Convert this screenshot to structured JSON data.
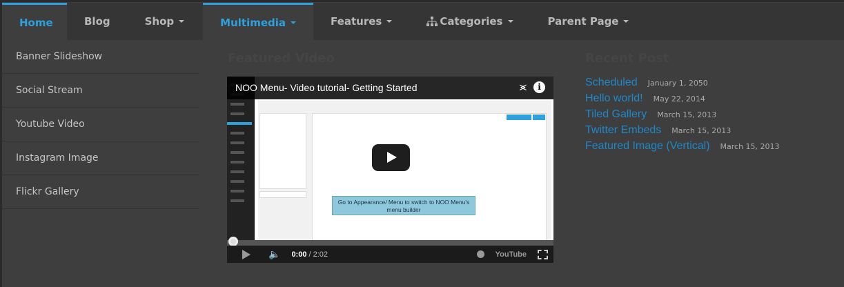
{
  "nav": [
    {
      "label": "Home",
      "dropdown": false,
      "active": true
    },
    {
      "label": "Blog",
      "dropdown": false
    },
    {
      "label": "Shop",
      "dropdown": true
    },
    {
      "label": "Multimedia",
      "dropdown": true,
      "active": true
    },
    {
      "label": "Features",
      "dropdown": true
    },
    {
      "label": "Categories",
      "dropdown": true,
      "icon": "sitemap-icon"
    },
    {
      "label": "Parent Page",
      "dropdown": true
    }
  ],
  "submenu": [
    "Banner Slideshow",
    "Social Stream",
    "Youtube Video",
    "Instagram Image",
    "Flickr Gallery"
  ],
  "featured_heading": "Featured Video",
  "video": {
    "title": "NOO Menu- Video tutorial- Getting Started",
    "annotation": "Go to Appearance/ Menu to switch to NOO Menu's menu builder",
    "current_time": "0:00",
    "duration": "/ 2:02",
    "brand": "YouTube",
    "progress": 0
  },
  "recent_heading": "Recent Post",
  "posts": [
    {
      "title": "Scheduled",
      "date": "January 1, 2050"
    },
    {
      "title": "Hello world!",
      "date": "May 22, 2014"
    },
    {
      "title": "Tiled Gallery",
      "date": "March 15, 2013"
    },
    {
      "title": "Twitter Embeds",
      "date": "March 15, 2013"
    },
    {
      "title": "Featured Image (Vertical)",
      "date": "March 15, 2013"
    }
  ],
  "colors": {
    "accent": "#2ea1dc",
    "link": "#1e88c8",
    "nav_bg": "#353535",
    "panel_bg": "#3e3e3e"
  }
}
